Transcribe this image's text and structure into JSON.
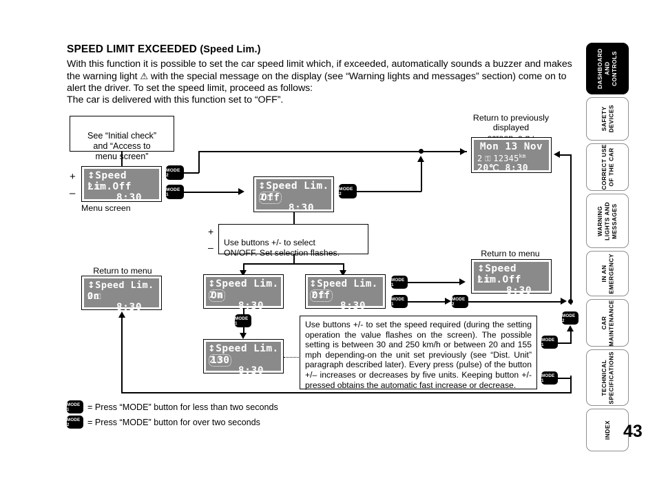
{
  "page": {
    "number": "43"
  },
  "heading": {
    "title": "SPEED LIMIT EXCEEDED",
    "subtitle": "(Speed Lim.)"
  },
  "intro": {
    "line1": "With this function it is possible to set the car speed limit which, if exceeded, automatically sounds a buzzer and",
    "line2_a": "makes the warning light",
    "warning_icon": "⚠",
    "line2_b": "with the special message on the display (see “Warning lights and messages” section) come",
    "line3": "on to alert the driver. To set the speed limit, proceed as follows:",
    "line4": "The car is delivered with this function set to “OFF”."
  },
  "tabs": [
    {
      "label": "DASHBOARD\nAND CONTROLS",
      "active": true
    },
    {
      "label": "SAFETY\nDEVICES",
      "active": false
    },
    {
      "label": "CORRECT USE\nOF THE CAR",
      "active": false
    },
    {
      "label": "WARNING\nLIGHTS AND\nMESSAGES",
      "active": false
    },
    {
      "label": "IN AN\nEMERGENCY",
      "active": false
    },
    {
      "label": "CAR\nMAINTENANCE",
      "active": false
    },
    {
      "label": "TECHNICAL\nSPECIFICATIONS",
      "active": false
    },
    {
      "label": "INDEX",
      "active": false
    }
  ],
  "notes": {
    "initial_check": "See “Initial check”\nand “Access to\nmenu screen”",
    "menu_screen": "Menu screen",
    "return_prev": "Return to previously\ndisplayed\nscreen, e.g.:",
    "return_menu_left": "Return to menu\nscreen",
    "return_menu_right": "Return to menu\nscreen",
    "select_onoff": "Use buttons +/- to select\nON/OFF. Set selection flashes.",
    "speed_set": "Use buttons +/- to set the speed required (during the setting operation the value flashes on the screen). The possible setting is between 30 and 250 km/h or between 20 and 155 mph depending-on the unit set previously (see “Dist. Unit” paragraph described later). Every press (pulse) of the button +/– increases or decreases by five units. Keeping button +/- pressed obtains the automatic fast increase or decrease.",
    "plus": "+",
    "minus": "–"
  },
  "screens": {
    "menu": {
      "line1": "Speed Lim.Off",
      "line2": "2",
      "line3": "8:30",
      "flash": ""
    },
    "edit_off": {
      "label": "Speed Lim.",
      "flash": "Off",
      "line2": "2",
      "line3": "8:30"
    },
    "clock": {
      "line1": "Mon 13 Nov",
      "odometer_label": "2",
      "odometer": "12345",
      "odometer_unit": "km",
      "temp": "20℃",
      "time": "8:30"
    },
    "result_on": {
      "line1": "Speed Lim. On",
      "line2": "2",
      "line3": "8:30"
    },
    "flash_on": {
      "label": "Speed Lim.",
      "flash": "On",
      "line2": "2",
      "line3": "8:30"
    },
    "flash_off": {
      "label": "Speed Lim.",
      "flash": "Off",
      "line2": "2",
      "line3": "8:30"
    },
    "flash_130": {
      "label": "Speed Lim.",
      "flash": "130",
      "line2": "2",
      "line3": "8:30"
    },
    "result_off": {
      "line1": "Speed Lim.Off",
      "line2": "2",
      "line3": "8:30"
    }
  },
  "mode_buttons": {
    "mode1": "MODE 1",
    "mode2": "MODE 2"
  },
  "legend": [
    {
      "badge": "MODE 1",
      "text": "= Press “MODE” button for less than two seconds"
    },
    {
      "badge": "MODE 2",
      "text": "= Press “MODE” button for over two seconds"
    }
  ]
}
